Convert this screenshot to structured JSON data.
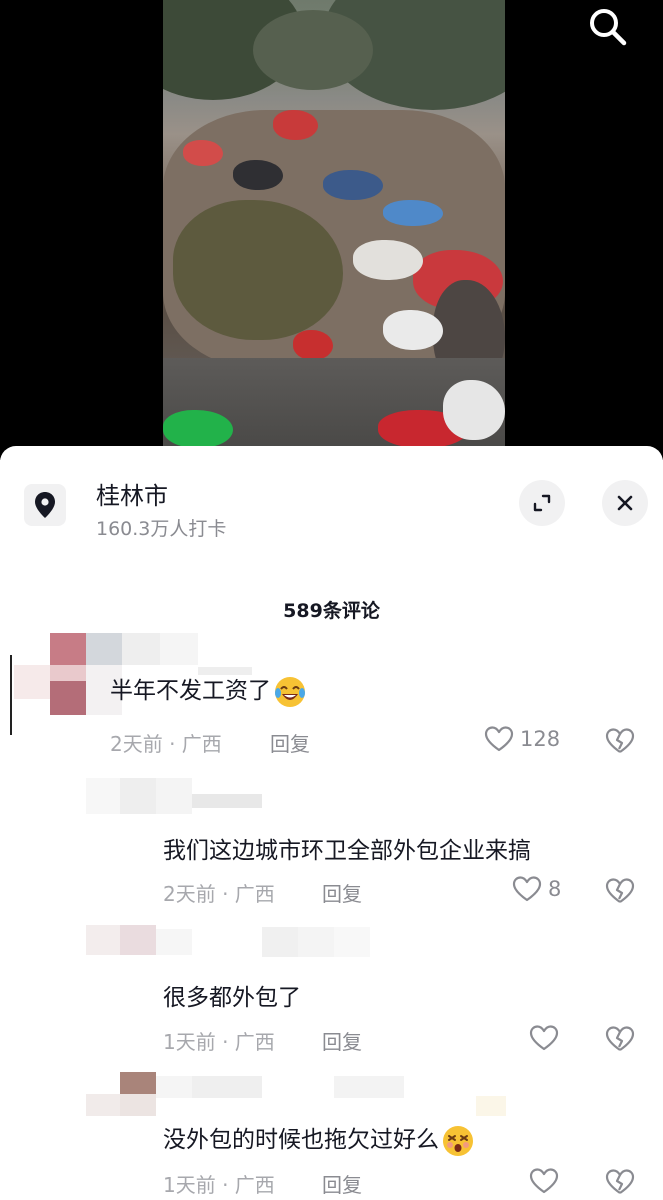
{
  "header": {
    "search_icon": "search-icon"
  },
  "location": {
    "title": "桂林市",
    "subtitle": "160.3万人打卡",
    "pin_icon": "location-pin-icon",
    "expand_icon": "expand-icon",
    "close_icon": "close-icon"
  },
  "comments_header": {
    "count_label": "589条评论"
  },
  "comments": [
    {
      "text": "半年不发工资了",
      "emoji": "laughing-crying-emoji",
      "time": "2天前 · 广西",
      "reply": "回复",
      "likes": "128"
    },
    {
      "text": "我们这边城市环卫全部外包企业来搞",
      "time": "2天前 · 广西",
      "reply": "回复",
      "likes": "8"
    },
    {
      "text": "很多都外包了",
      "time": "1天前 · 广西",
      "reply": "回复",
      "likes": ""
    },
    {
      "text": "没外包的时候也拖欠过好么",
      "emoji": "dizzy-face-emoji",
      "time": "1天前 · 广西",
      "reply": "回复",
      "likes": ""
    }
  ],
  "colors": {
    "text": "#161823",
    "muted": "#8a8b91",
    "meta": "#a7a8ad",
    "icon_bg": "#f1f1f2"
  }
}
